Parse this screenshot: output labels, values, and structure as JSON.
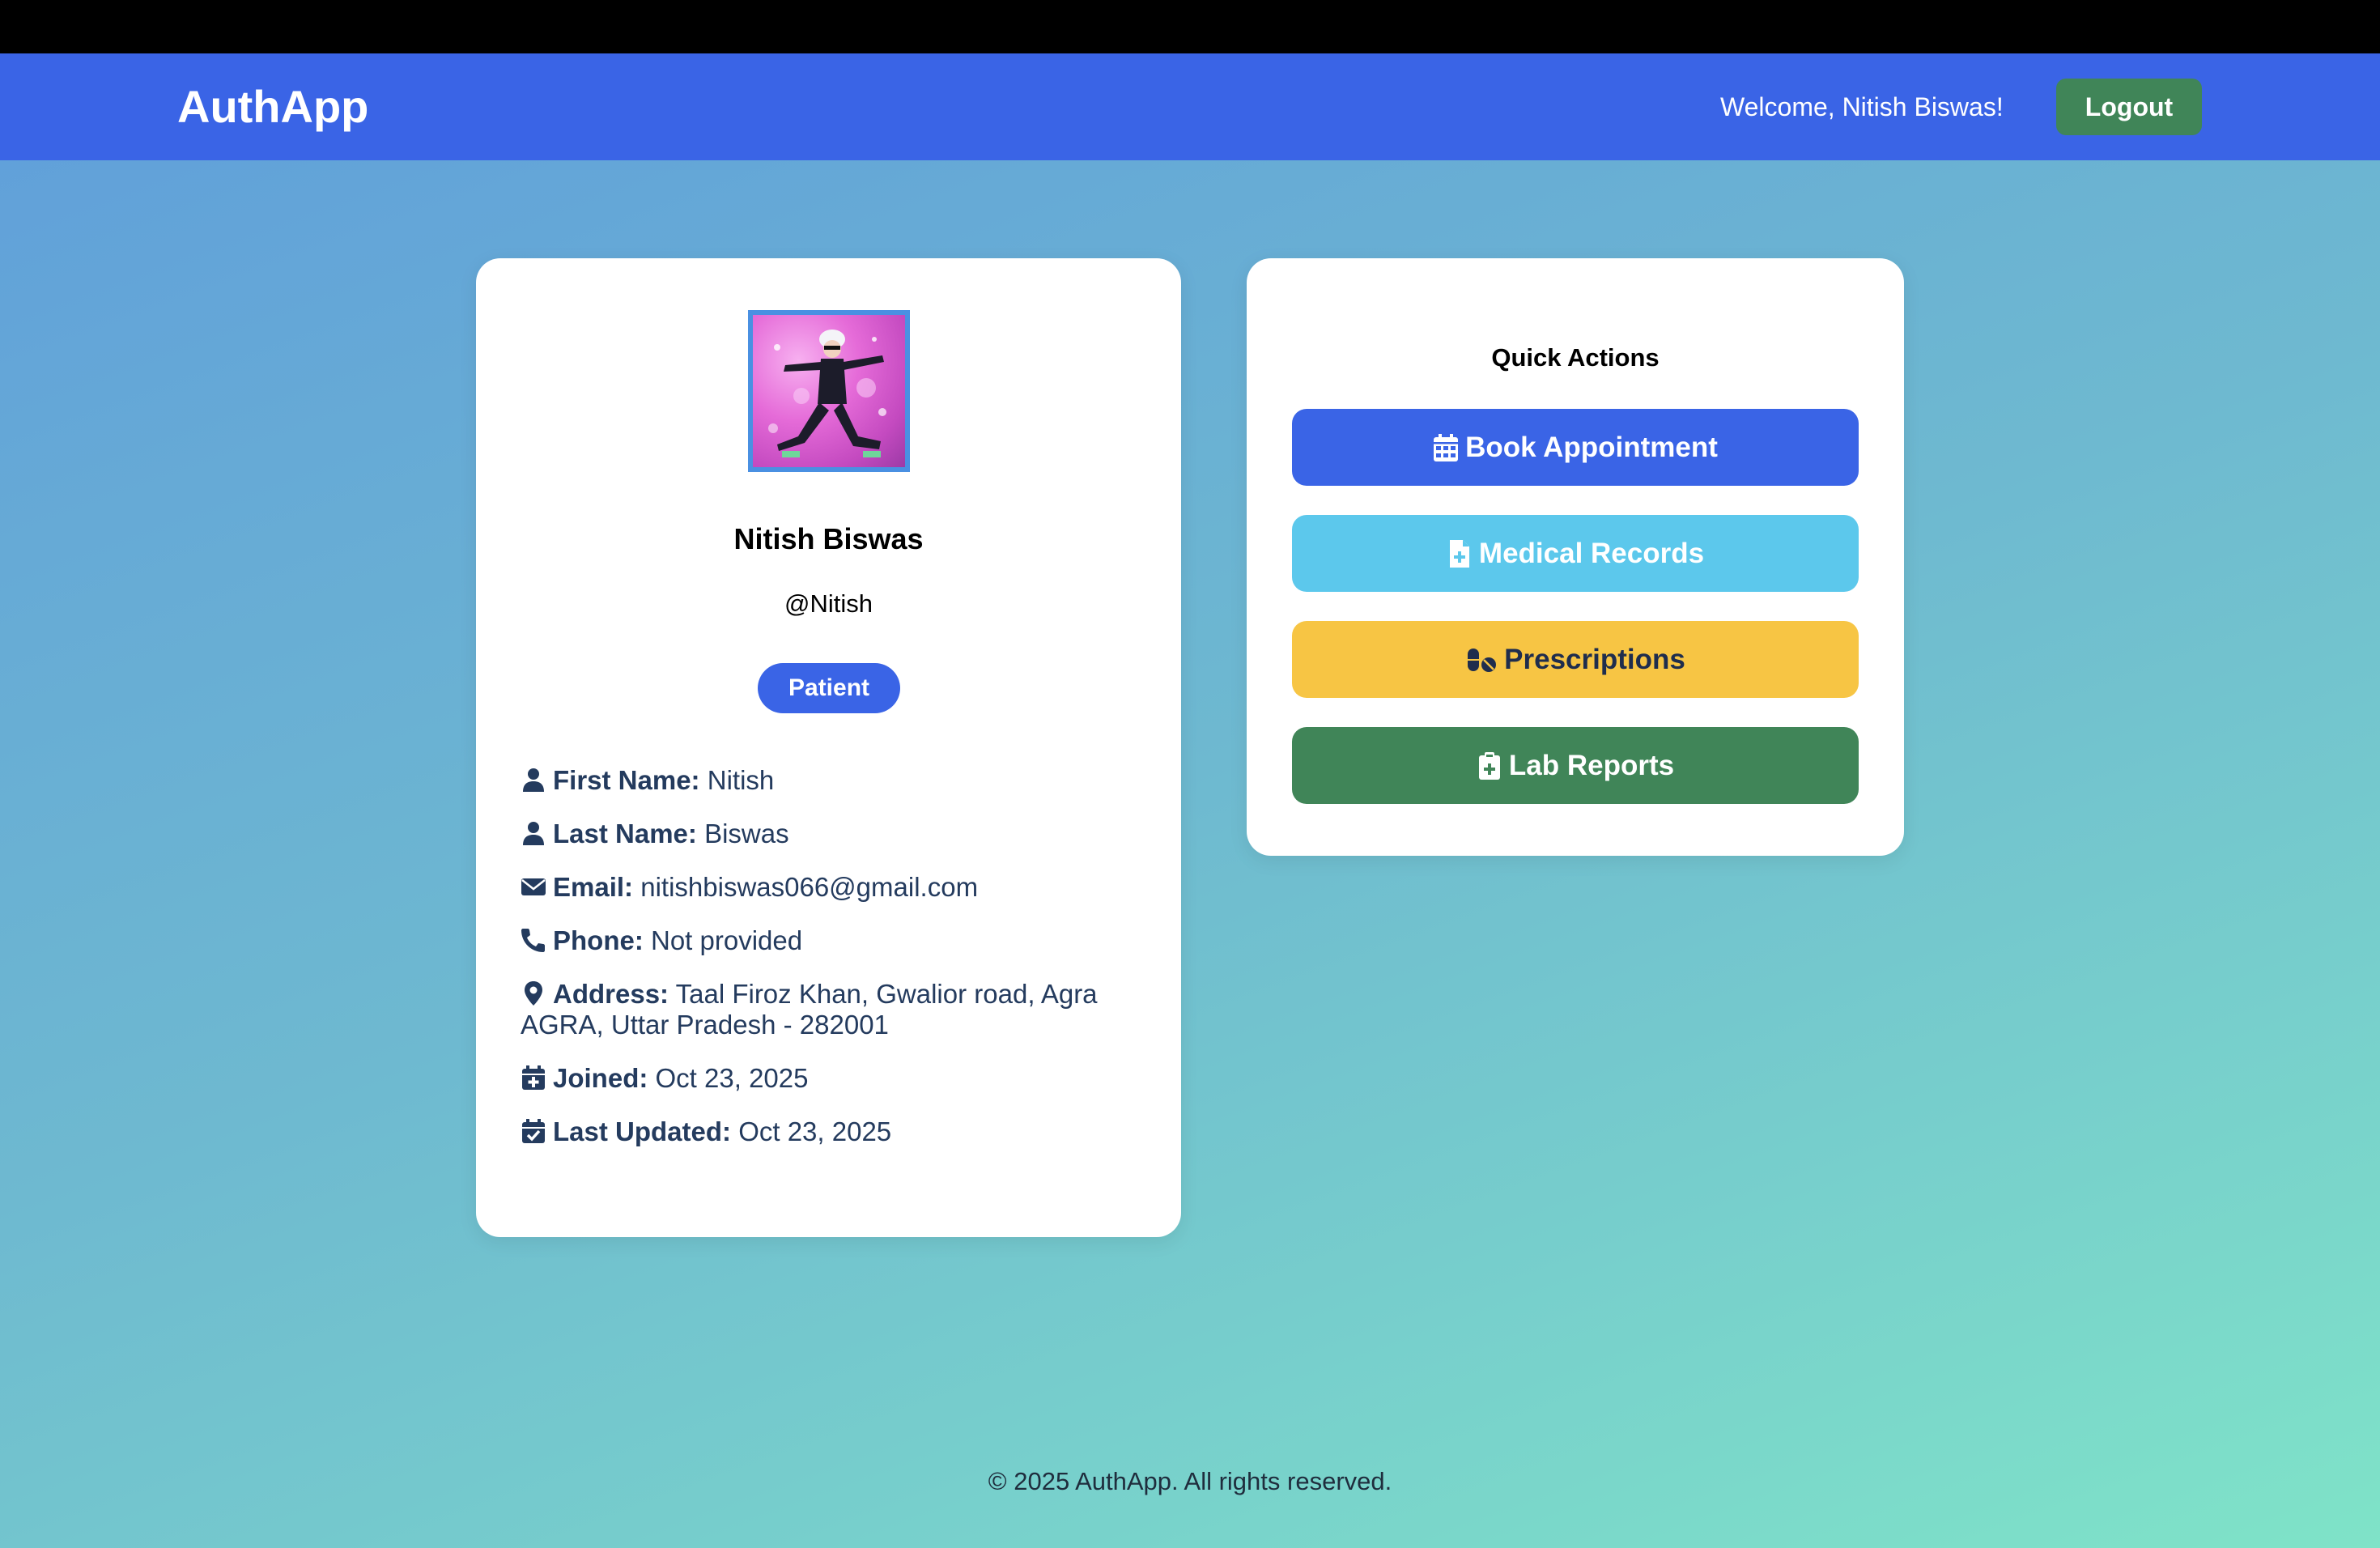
{
  "navbar": {
    "brand": "AuthApp",
    "welcome": "Welcome, Nitish Biswas!",
    "logout_label": "Logout"
  },
  "profile": {
    "full_name": "Nitish Biswas",
    "username": "@Nitish",
    "role": "Patient",
    "fields": {
      "first_name": {
        "label": "First Name:",
        "value": "Nitish",
        "icon": "user-icon"
      },
      "last_name": {
        "label": "Last Name:",
        "value": "Biswas",
        "icon": "user-icon"
      },
      "email": {
        "label": "Email:",
        "value": "nitishbiswas066@gmail.com",
        "icon": "envelope-icon"
      },
      "phone": {
        "label": "Phone:",
        "value": "Not provided",
        "icon": "phone-icon"
      },
      "address": {
        "label": "Address:",
        "value_line1": "Taal Firoz Khan, Gwalior road, Agra",
        "value_line2": "AGRA, Uttar Pradesh - 282001",
        "icon": "map-pin-icon"
      },
      "joined": {
        "label": "Joined:",
        "value": "Oct 23, 2025",
        "icon": "calendar-plus-icon"
      },
      "last_updated": {
        "label": "Last Updated:",
        "value": "Oct 23, 2025",
        "icon": "calendar-check-icon"
      }
    }
  },
  "quick_actions": {
    "title": "Quick Actions",
    "buttons": [
      {
        "label": "Book Appointment",
        "icon": "calendar-icon",
        "color": "#3a64e6"
      },
      {
        "label": "Medical Records",
        "icon": "file-medical-icon",
        "color": "#5cc8ec"
      },
      {
        "label": "Prescriptions",
        "icon": "pills-icon",
        "color": "#f7c544"
      },
      {
        "label": "Lab Reports",
        "icon": "clipboard-medical-icon",
        "color": "#408558"
      }
    ]
  },
  "footer": {
    "text": "© 2025 AuthApp. All rights reserved."
  },
  "colors": {
    "navbar": "#3a64e6",
    "logout": "#408558",
    "text_dark": "#243b5e"
  }
}
